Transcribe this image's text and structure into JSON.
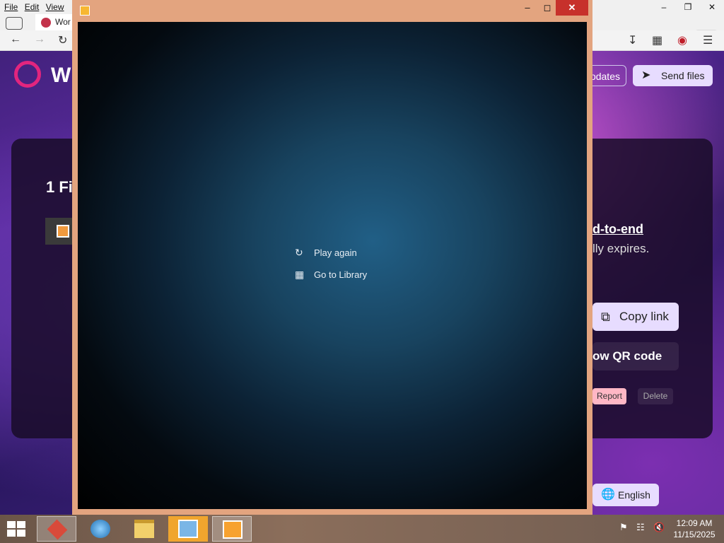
{
  "browser": {
    "menu": [
      "File",
      "Edit",
      "View"
    ],
    "tab_title": "Wor",
    "tab_count": "1",
    "site_logo_text": "W",
    "updates_label": "odates",
    "send_files_label": "Send files",
    "card_title": "1 Fi",
    "end_to_end_text": "d-to-end",
    "expires_text": "lly expires.",
    "copy_link_label": "Copy link",
    "qr_label": "ow QR code",
    "report_label": "Report",
    "delete_label": "Delete",
    "language_label": "English"
  },
  "player": {
    "play_again_label": "Play again",
    "go_to_library_label": "Go to Library",
    "accent_color": "#e3a47f",
    "close_color": "#c7312b"
  },
  "taskbar": {
    "clock_time": "12:09 AM",
    "clock_date": "11/15/2025"
  }
}
